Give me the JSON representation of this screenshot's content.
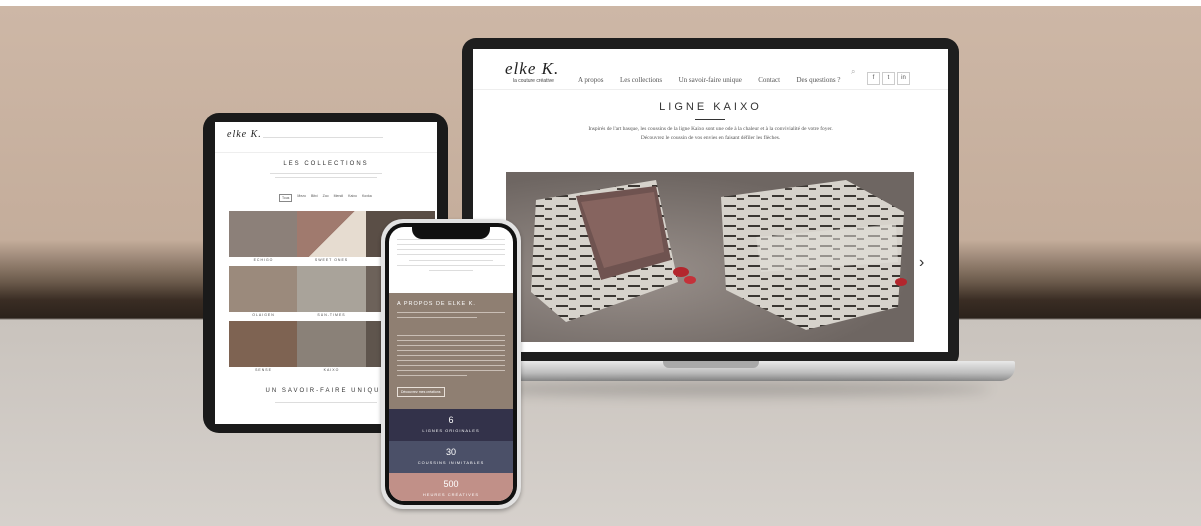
{
  "laptop": {
    "logo_script": "elke K.",
    "logo_tag": "la couture créative",
    "nav": [
      "A propos",
      "Les collections",
      "Un savoir-faire unique",
      "Contact",
      "Des questions ?"
    ],
    "social": [
      "f",
      "t",
      "in"
    ],
    "page_title": "LIGNE KAIXO",
    "intro_line1": "Inspirés de l'art basque, les coussins de la ligne Kaixo sont une ode à la chaleur et à la convivialité de votre foyer.",
    "intro_line2": "Découvrez le coussin de vos envies en faisant défiler les flèches.",
    "next_arrow": "›"
  },
  "tablet": {
    "logo_script": "elke K.",
    "section_title": "LES COLLECTIONS",
    "filters": [
      "Tous",
      "Mezo",
      "Bitxi",
      "Zoo",
      "Mendi",
      "Kaixo",
      "Koxka"
    ],
    "collections": [
      "ECHIGO",
      "SWEET ONES",
      "",
      "OLAIGEN",
      "SUN-TIMES",
      "",
      "SENSE",
      "KAIXO",
      ""
    ],
    "savoir_title": "UN SAVOIR-FAIRE UNIQUE"
  },
  "phone": {
    "about_title": "A PROPOS DE ELKE K.",
    "about_button": "Découvrez mes créations",
    "stats": [
      {
        "value": "6",
        "label": "LIGNES ORIGINALES"
      },
      {
        "value": "30",
        "label": "COUSSINS INIMITABLES"
      },
      {
        "value": "500",
        "label": "HEURES CRÉATIVES"
      }
    ]
  },
  "colors": {
    "about_bg": "#8f7f72",
    "stat1_bg": "#33324a",
    "stat2_bg": "#4b5068",
    "stat3_bg": "#c19088"
  }
}
